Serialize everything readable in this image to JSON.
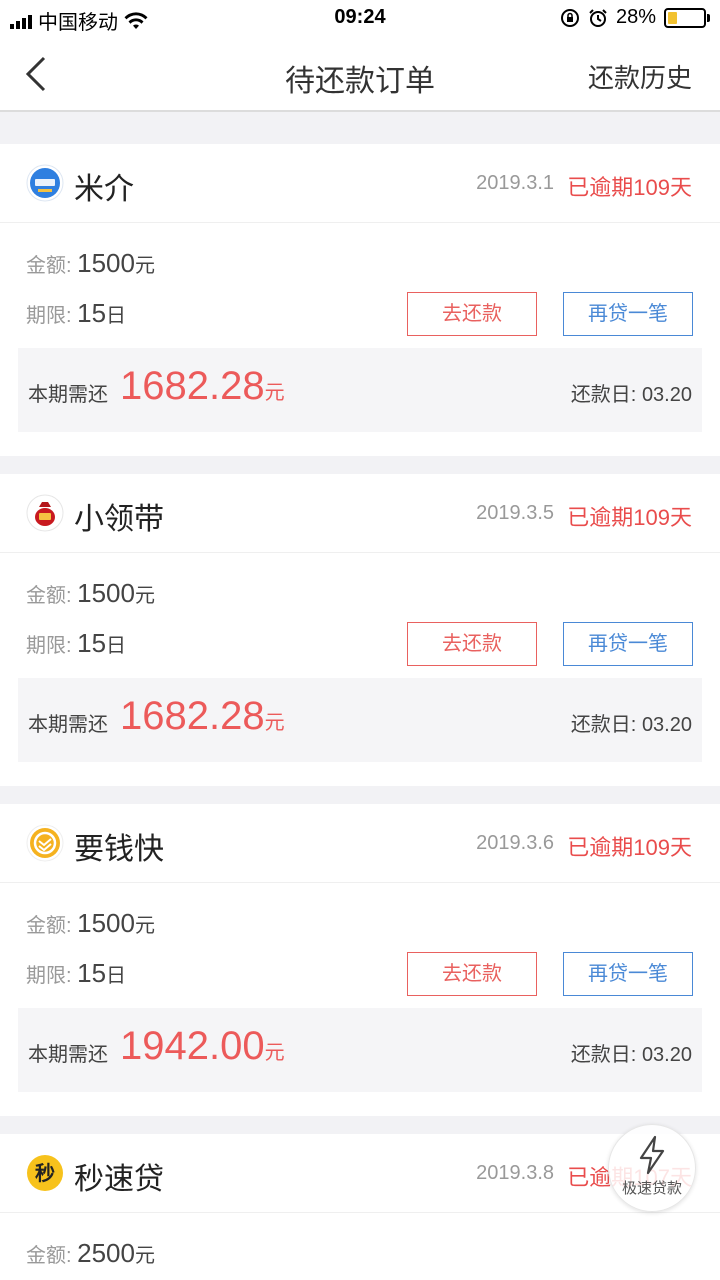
{
  "status": {
    "carrier": "中国移动",
    "time": "09:24",
    "battery": "28%"
  },
  "nav": {
    "title": "待还款订单",
    "history": "还款历史"
  },
  "labels": {
    "amount": "金额:",
    "term": "期限:",
    "due": "本期需还",
    "repay_day": "还款日:",
    "yuan": "元",
    "day": "日",
    "repay_btn": "去还款",
    "again_btn": "再贷一笔"
  },
  "orders": [
    {
      "name": "米介",
      "date": "2019.3.1",
      "overdue": "已逾期109天",
      "amount": "1500",
      "term": "15",
      "due_amount": "1682.28",
      "repay_date": "03.20"
    },
    {
      "name": "小领带",
      "date": "2019.3.5",
      "overdue": "已逾期109天",
      "amount": "1500",
      "term": "15",
      "due_amount": "1682.28",
      "repay_date": "03.20"
    },
    {
      "name": "要钱快",
      "date": "2019.3.6",
      "overdue": "已逾期109天",
      "amount": "1500",
      "term": "15",
      "due_amount": "1942.00",
      "repay_date": "03.20"
    },
    {
      "name": "秒速贷",
      "date": "2019.3.8",
      "overdue": "已逾期107天",
      "amount": "2500"
    }
  ],
  "fab": {
    "label": "极速贷款"
  },
  "colors": {
    "overdue": "#e94c4c",
    "repay": "#e9615f",
    "again": "#4a89d6",
    "battery": "#f2c230"
  }
}
